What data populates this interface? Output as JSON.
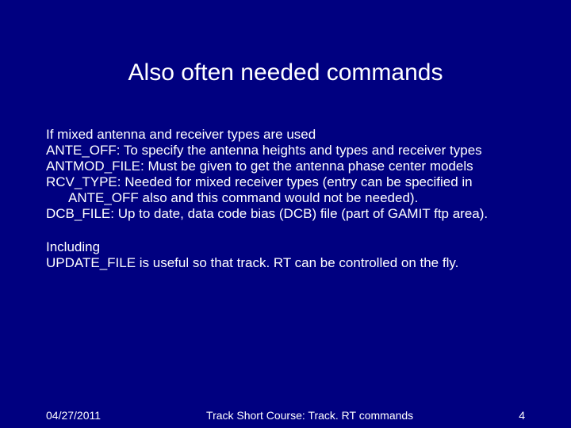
{
  "title": "Also often needed commands",
  "body": {
    "intro1": "If mixed antenna and receiver types are used",
    "ante_off": "ANTE_OFF: To specify the antenna heights and types and receiver types",
    "antmod_file": "ANTMOD_FILE: Must be given to get the antenna phase center models",
    "rcv_type": "RCV_TYPE: Needed for mixed receiver types (entry can be specified in ANTE_OFF also and this command would not be needed).",
    "dcb_file": "DCB_FILE: Up to date, data code bias (DCB) file (part of GAMIT ftp area).",
    "including": "Including",
    "update_file": "UPDATE_FILE is useful so that track. RT can be controlled on the fly."
  },
  "footer": {
    "date": "04/27/2011",
    "center": "Track Short Course: Track. RT commands",
    "page": "4"
  }
}
